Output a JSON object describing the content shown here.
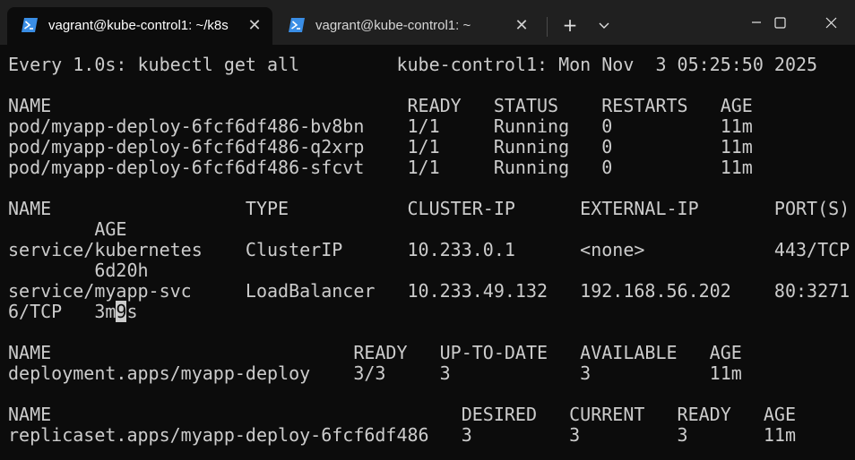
{
  "window": {
    "colors": {
      "titlebar": "#202020",
      "terminal_bg": "#0c0c0c",
      "terminal_text": "#cccccc",
      "powershell_icon": "#3a8ee6"
    },
    "tabs": [
      {
        "title": "vagrant@kube-control1: ~/k8s",
        "icon": "powershell-icon",
        "active": true
      },
      {
        "title": "vagrant@kube-control1: ~",
        "icon": "powershell-icon",
        "active": false
      }
    ],
    "new_tab_label": "+",
    "dropdown_label": "⌄",
    "controls": [
      "minimize-icon",
      "maximize-icon",
      "close-icon"
    ]
  },
  "terminal": {
    "lines": [
      "Every 1.0s: kubectl get all         kube-control1: Mon Nov  3 05:25:50 2025",
      "",
      "NAME                                 READY   STATUS    RESTARTS   AGE",
      "pod/myapp-deploy-6fcf6df486-bv8bn    1/1     Running   0          11m",
      "pod/myapp-deploy-6fcf6df486-q2xrp    1/1     Running   0          11m",
      "pod/myapp-deploy-6fcf6df486-sfcvt    1/1     Running   0          11m",
      "",
      "NAME                  TYPE           CLUSTER-IP      EXTERNAL-IP       PORT(S)",
      "        AGE",
      "service/kubernetes    ClusterIP      10.233.0.1      <none>            443/TCP",
      "        6d20h",
      "service/myapp-svc     LoadBalancer   10.233.49.132   192.168.56.202    80:3271",
      "6/TCP   3m9s",
      "",
      "NAME                            READY   UP-TO-DATE   AVAILABLE   AGE",
      "deployment.apps/myapp-deploy    3/3     3            3           11m",
      "",
      "NAME                                      DESIRED   CURRENT   READY   AGE",
      "replicaset.apps/myapp-deploy-6fcf6df486   3         3         3       11m"
    ],
    "cursor": {
      "line": 12,
      "before": "6/TCP   3m",
      "char": "9",
      "after": "s"
    }
  }
}
